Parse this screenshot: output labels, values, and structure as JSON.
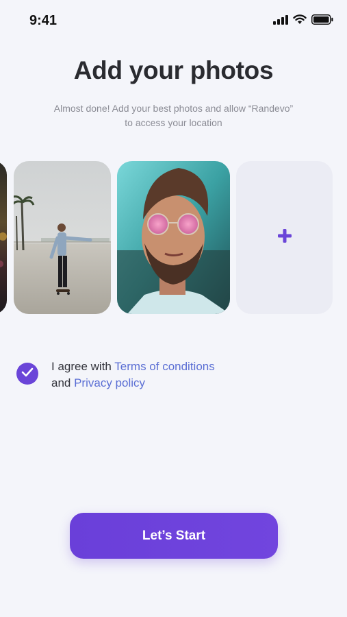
{
  "status_bar": {
    "time": "9:41",
    "icons": [
      "signal-icon",
      "wifi-icon",
      "battery-icon"
    ]
  },
  "header": {
    "title": "Add your photos",
    "subtitle_line1": "Almost done! Add your best photos and allow “Randevo”",
    "subtitle_line2": "to access your location"
  },
  "photos": {
    "items": [
      "photo-partial",
      "photo-skateboarder",
      "photo-man-sunglasses"
    ],
    "add_button_label": "+"
  },
  "agreement": {
    "checked": true,
    "prefix": "I agree with ",
    "terms_link": "Terms of conditions",
    "joiner": "and ",
    "privacy_link": "Privacy policy"
  },
  "cta": {
    "label": "Let’s Start"
  },
  "colors": {
    "accent": "#6a45d8",
    "link": "#5b6fd4",
    "background": "#f4f5fa",
    "add_card": "#ebecf4"
  }
}
